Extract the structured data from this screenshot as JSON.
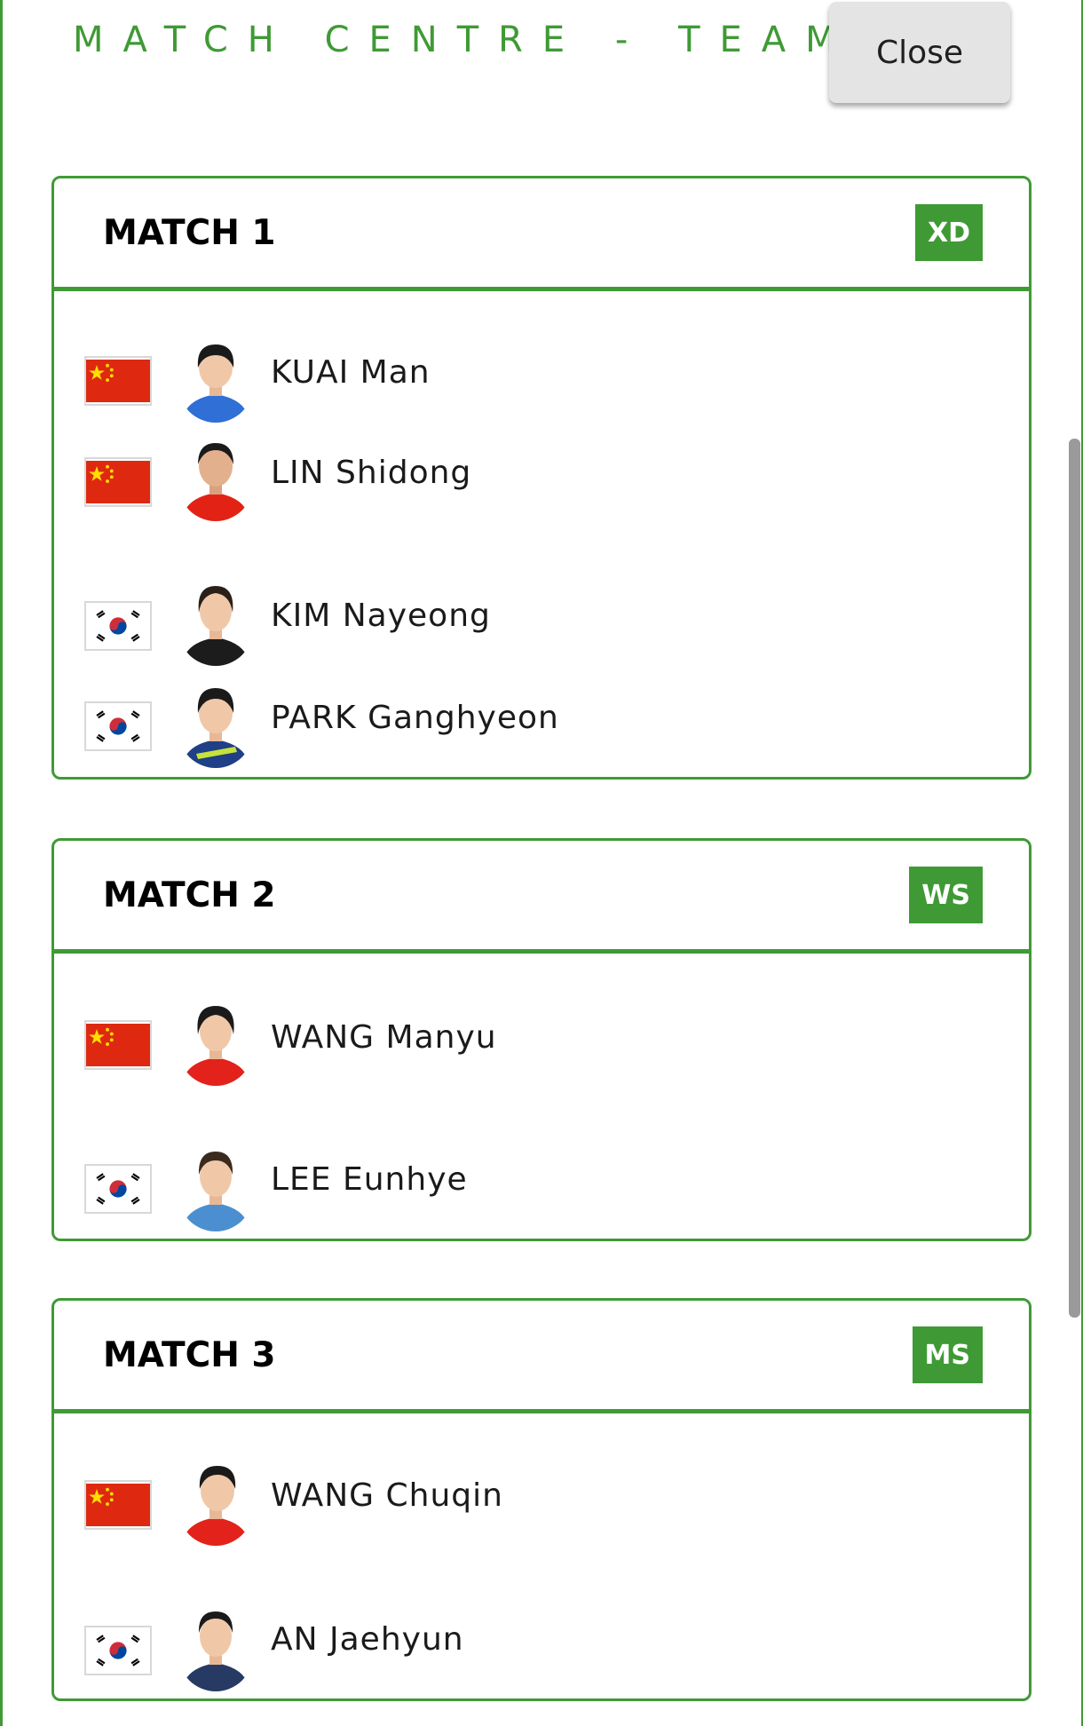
{
  "page": {
    "title": "MATCH CENTRE - TEAMS",
    "close_label": "Close"
  },
  "colors": {
    "accent": "#3f9a35",
    "close_button_bg": "#e4e4e4"
  },
  "matches": [
    {
      "title": "MATCH 1",
      "badge": "XD",
      "players": [
        {
          "name": "KUAI Man",
          "flag": "china-flag-icon",
          "jersey": "#2f6fd6"
        },
        {
          "name": "LIN Shidong",
          "flag": "china-flag-icon",
          "jersey": "#e32216"
        },
        {
          "name": "KIM Nayeong",
          "flag": "korea-flag-icon",
          "jersey": "#1c1c1c"
        },
        {
          "name": "PARK Ganghyeon",
          "flag": "korea-flag-icon",
          "jersey": "#1f3f86"
        }
      ]
    },
    {
      "title": "MATCH 2",
      "badge": "WS",
      "players": [
        {
          "name": "WANG Manyu",
          "flag": "china-flag-icon",
          "jersey": "#e3221c"
        },
        {
          "name": "LEE Eunhye",
          "flag": "korea-flag-icon",
          "jersey": "#4b8fd0"
        }
      ]
    },
    {
      "title": "MATCH 3",
      "badge": "MS",
      "players": [
        {
          "name": "WANG Chuqin",
          "flag": "china-flag-icon",
          "jersey": "#e3221c"
        },
        {
          "name": "AN Jaehyun",
          "flag": "korea-flag-icon",
          "jersey": "#263a63"
        }
      ]
    }
  ]
}
